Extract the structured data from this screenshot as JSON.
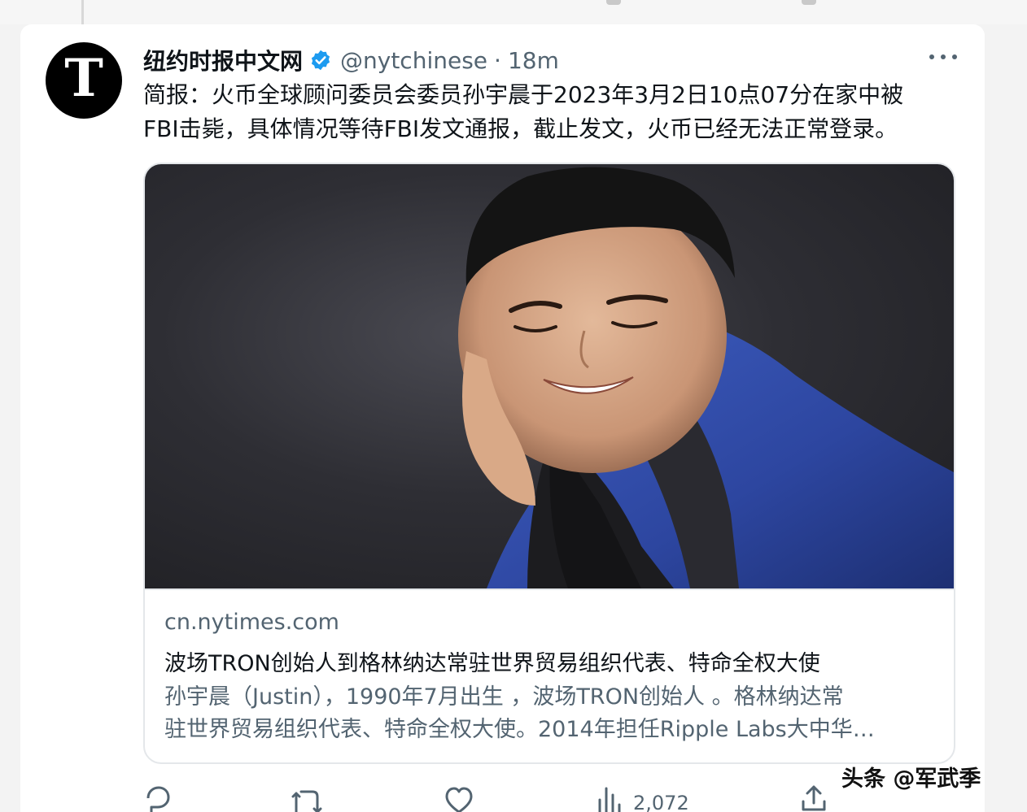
{
  "tweet": {
    "display_name": "纽约时报中文网",
    "avatar_letter": "T",
    "handle": "@nytchinese",
    "separator": "·",
    "time": "18m",
    "text": "简报：火币全球顾问委员会委员孙宇晨于2023年3月2日10点07分在家中被\nFBI击毙，具体情况等待FBI发文通报，截止发文，火币已经无法正常登录。",
    "verified_color": "#1d9bf0"
  },
  "link_card": {
    "domain": "cn.nytimes.com",
    "title": "波场TRON创始人到格林纳达常驻世界贸易组织代表、特命全权大使",
    "description": "孙宇晨（Justin），1990年7月出生 ，波场TRON创始人 。格林纳达常\n驻世界贸易组织代表、特命全权大使。2014年担任Ripple Labs大中华…"
  },
  "actions": {
    "views": "2,072",
    "icons": [
      "reply-icon",
      "retweet-icon",
      "like-icon",
      "views-icon",
      "share-icon"
    ]
  },
  "watermark": {
    "main": "头条 @军武季"
  }
}
